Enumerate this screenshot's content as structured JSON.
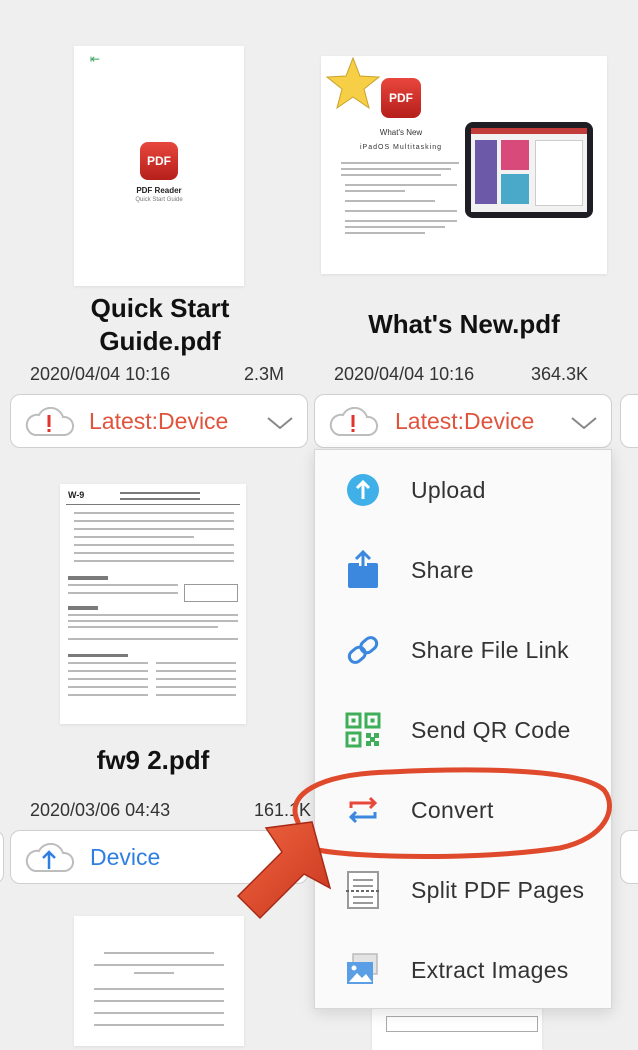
{
  "files": [
    {
      "name": "Quick Start Guide.pdf",
      "name_lines": [
        "Quick Start",
        "Guide.pdf"
      ],
      "date": "2020/04/04 10:16",
      "size": "2.3M",
      "status": "Latest:Device",
      "thumb_title": "PDF Reader",
      "thumb_subtitle": "Quick Start Guide"
    },
    {
      "name": "What's New.pdf",
      "name_lines": [
        "What's New.pdf"
      ],
      "date": "2020/04/04 10:16",
      "size": "364.3K",
      "status": "Latest:Device",
      "thumb_heading": "What's New",
      "thumb_subheading": "iPadOS Multitasking"
    },
    {
      "name": "fw9 2.pdf",
      "name_lines": [
        "fw9 2.pdf"
      ],
      "date": "2020/03/06 04:43",
      "size": "161.1K",
      "status": "Device",
      "thumb_form": "W-9"
    }
  ],
  "menu": {
    "items": [
      {
        "label": "Upload",
        "icon": "upload-icon"
      },
      {
        "label": "Share",
        "icon": "share-icon"
      },
      {
        "label": "Share File Link",
        "icon": "link-icon"
      },
      {
        "label": "Send QR Code",
        "icon": "qr-code-icon"
      },
      {
        "label": "Convert",
        "icon": "convert-icon"
      },
      {
        "label": "Split PDF Pages",
        "icon": "split-pages-icon"
      },
      {
        "label": "Extract Images",
        "icon": "extract-images-icon"
      }
    ],
    "highlighted": "Convert"
  },
  "colors": {
    "warning_red": "#e0533d",
    "device_blue": "#2f7fe0",
    "pdf_brand": "#d9302a",
    "annotation": "#e04a2c"
  }
}
